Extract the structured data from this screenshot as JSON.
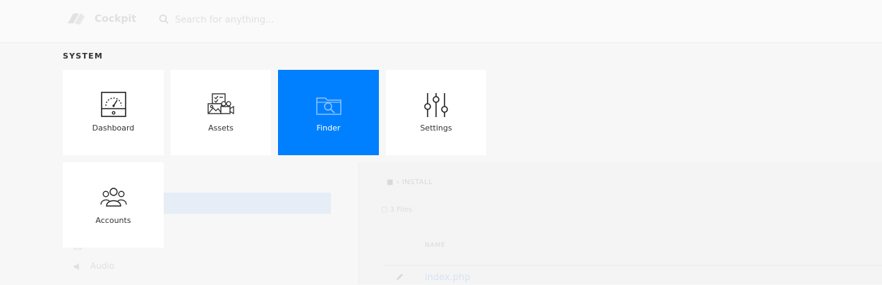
{
  "header": {
    "app_title": "Cockpit",
    "search_placeholder": "Search for anything..."
  },
  "system_menu": {
    "section_label": "SYSTEM",
    "items": [
      {
        "label": "Dashboard",
        "icon": "dashboard-gauge-icon",
        "active": false
      },
      {
        "label": "Assets",
        "icon": "assets-icon",
        "active": false
      },
      {
        "label": "Finder",
        "icon": "folder-search-icon",
        "active": true
      },
      {
        "label": "Settings",
        "icon": "sliders-icon",
        "active": false
      },
      {
        "label": "Accounts",
        "icon": "users-icon",
        "active": false
      }
    ]
  },
  "background": {
    "path_label": "INSTALL",
    "files_count": "3 Files",
    "name_column": "NAME",
    "file_name": "index.php",
    "sidebar_items": [
      "Audio"
    ]
  },
  "colors": {
    "accent": "#0080ff",
    "tile_bg": "#ffffff",
    "page_bg": "#f7f7f7"
  }
}
